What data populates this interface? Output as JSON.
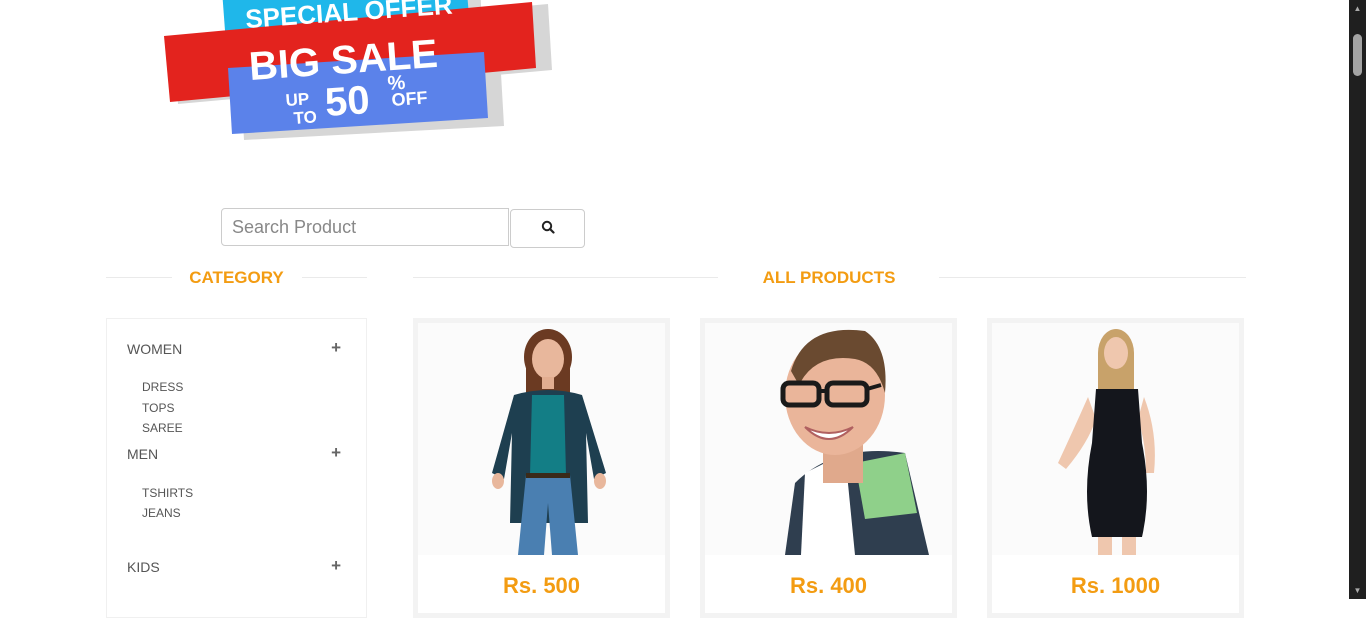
{
  "banner": {
    "line1": "SPECIAL OFFER",
    "line2": "BIG SALE",
    "upto_up": "UP",
    "upto_to": "TO",
    "percent_value": "50",
    "percent_sign": "%",
    "off": "OFF"
  },
  "search": {
    "placeholder": "Search Product",
    "value": ""
  },
  "category": {
    "title": "CATEGORY",
    "groups": [
      {
        "label": "WOMEN",
        "toggle": "+",
        "items": [
          "DRESS",
          "TOPS",
          "SAREE"
        ]
      },
      {
        "label": "MEN",
        "toggle": "+",
        "items": [
          "TSHIRTS",
          "JEANS"
        ]
      },
      {
        "label": "KIDS",
        "toggle": "+",
        "items": []
      }
    ]
  },
  "products": {
    "title": "ALL PRODUCTS",
    "items": [
      {
        "price": "Rs. 500",
        "image": "woman-cardigan-jeans"
      },
      {
        "price": "Rs. 400",
        "image": "man-glasses-polo"
      },
      {
        "price": "Rs. 1000",
        "image": "woman-black-dress"
      }
    ]
  },
  "colors": {
    "accent": "#f39c12",
    "banner_cyan": "#1fb7ea",
    "banner_red": "#e3231e",
    "banner_blue": "#5b82ea"
  },
  "icons": {
    "search": "search-icon"
  }
}
